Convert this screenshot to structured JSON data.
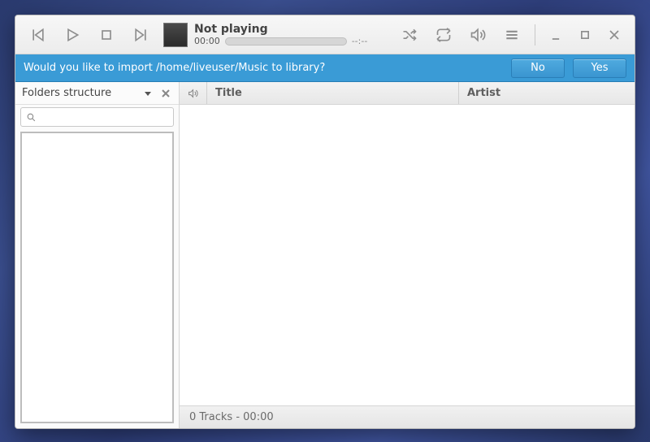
{
  "nowplaying": {
    "title": "Not playing",
    "elapsed": "00:00",
    "remaining": "--:--"
  },
  "banner": {
    "message": "Would you like to import /home/liveuser/Music to library?",
    "no": "No",
    "yes": "Yes"
  },
  "sidebar": {
    "title": "Folders structure",
    "search_placeholder": ""
  },
  "columns": {
    "title": "Title",
    "artist": "Artist"
  },
  "status": {
    "text": "0 Tracks - 00:00"
  }
}
